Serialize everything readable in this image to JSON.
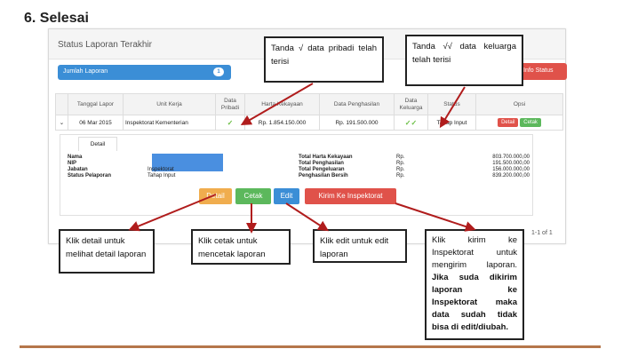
{
  "step_title": "6.  Selesai",
  "panel_title": "Status Laporan Terakhir",
  "jumlah_label": "Jumlah Laporan",
  "jumlah_count": "1",
  "info_button": "Info Status",
  "table": {
    "headers": [
      "Tanggal Lapor",
      "Unit Kerja",
      "Data Pribadi",
      "Harta Kekayaan",
      "Data Penghasilan",
      "Data Keluarga",
      "Status",
      "Opsi"
    ],
    "row": {
      "tanggal": "06 Mar 2015",
      "unit": "Inspektorat Kementerian",
      "pribadi": "✓",
      "harta": "Rp. 1.854.150.000",
      "penghasilan": "Rp. 191.500.000",
      "keluarga": "✓✓",
      "status": "Tahap Input",
      "opsi_detail": "Detail",
      "opsi_cetak": "Cetak"
    }
  },
  "detail": {
    "tab": "Detail",
    "left_labels": [
      "Nama",
      "NIP",
      "Jabatan",
      "Status Pelaporan"
    ],
    "left_values": [
      "",
      "",
      "Inspektorat",
      "Tahap Input"
    ],
    "right_labels": [
      "Total Harta Kekayaan",
      "Total Penghasilan",
      "Total Pengeluaran",
      "Penghasilan Bersih"
    ],
    "currency": [
      "Rp.",
      "Rp.",
      "Rp.",
      "Rp."
    ],
    "amounts": [
      "803.700.000,00",
      "191.500.000,00",
      "156.000.000,00",
      "839.200.000,00"
    ]
  },
  "actions": {
    "detail": "Detail",
    "cetak": "Cetak",
    "edit": "Edit",
    "kirim": "Kirim Ke Inspektorat"
  },
  "pager": "1-1 of 1",
  "callouts": {
    "pribadi": "Tanda    √    data pribadi telah terisi",
    "keluarga": "Tanda    √√    data keluarga    telah terisi",
    "detail": "Klik detail untuk melihat detail laporan",
    "cetak": "Klik cetak untuk mencetak laporan",
    "edit": "Klik edit untuk edit laporan",
    "kirim_plain": "Klik kirim ke Inspektorat untuk mengirim laporan.",
    "kirim_bold": "Jika suda dikirim laporan ke Inspektorat maka data sudah tidak bisa di edit/diubah."
  },
  "colors": {
    "primary": "#3b8ed6",
    "danger": "#e0524a",
    "success": "#5cb85c",
    "warning": "#f0ad4e",
    "arrow": "#b01c1c",
    "rule": "#b5764a"
  }
}
